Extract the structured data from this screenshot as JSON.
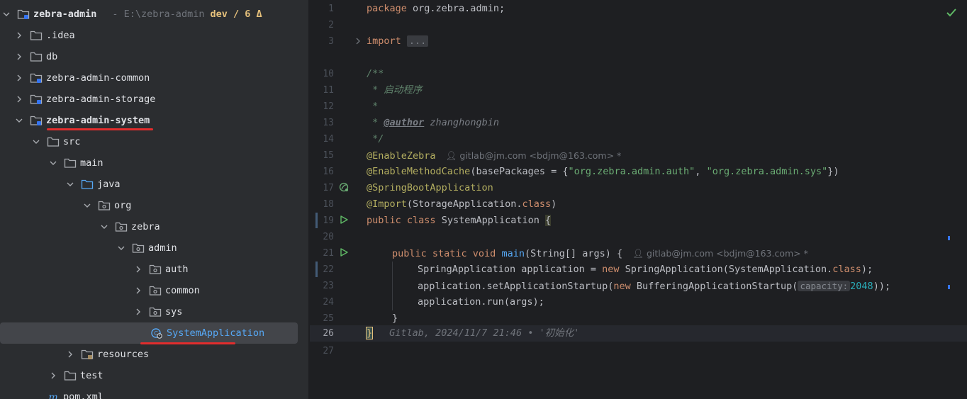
{
  "project_tree": {
    "root": {
      "name": "zebra-admin",
      "path": "- E:\\zebra-admin",
      "branch": "dev / 6 Δ"
    },
    "items": [
      {
        "label": ".idea"
      },
      {
        "label": "db"
      },
      {
        "label": "zebra-admin-common"
      },
      {
        "label": "zebra-admin-storage"
      },
      {
        "label": "zebra-admin-system"
      },
      {
        "label": "src"
      },
      {
        "label": "main"
      },
      {
        "label": "java"
      },
      {
        "label": "org"
      },
      {
        "label": "zebra"
      },
      {
        "label": "admin"
      },
      {
        "label": "auth"
      },
      {
        "label": "common"
      },
      {
        "label": "sys"
      },
      {
        "label": "SystemApplication"
      },
      {
        "label": "resources"
      },
      {
        "label": "test"
      },
      {
        "label": "pom.xml"
      }
    ]
  },
  "editor": {
    "line_numbers": [
      "1",
      "2",
      "3",
      "10",
      "11",
      "12",
      "13",
      "14",
      "15",
      "16",
      "17",
      "18",
      "19",
      "20",
      "21",
      "22",
      "23",
      "24",
      "25",
      "26",
      "27"
    ],
    "code": {
      "l1_kw": "package",
      "l1_rest": " org.zebra.admin;",
      "l3_kw": "import",
      "l3_fold": "...",
      "l10": "/**",
      "l11": " * 启动程序",
      "l12": " *",
      "l13_pre": " * ",
      "l13_tag": "@author",
      "l13_name": " zhanghongbin",
      "l14": " */",
      "l15_ann": "@EnableZebra",
      "l15_blame": "gitlab@jm.com <bdjm@163.com> *",
      "l16_ann": "@EnableMethodCache",
      "l16_a": "(basePackages = {",
      "l16_s1": "\"org.zebra.admin.auth\"",
      "l16_b": ", ",
      "l16_s2": "\"org.zebra.admin.sys\"",
      "l16_c": "})",
      "l17_ann": "@SpringBootApplication",
      "l18_ann": "@Import",
      "l18_a": "(StorageApplication.",
      "l18_kw": "class",
      "l18_b": ")",
      "l19_kw1": "public",
      "l19_kw2": "class",
      "l19_name": " SystemApplication ",
      "l19_brace": "{",
      "l21_kw": "public static void",
      "l21_fn": "main",
      "l21_rest": "(String[] args) {",
      "l21_blame": "gitlab@jm.com <bdjm@163.com> *",
      "l22_a": "SpringApplication application = ",
      "l22_kw": "new",
      "l22_b": " SpringApplication(SystemApplication.",
      "l22_kw2": "class",
      "l22_c": ");",
      "l23_a": "application.setApplicationStartup(",
      "l23_kw": "new",
      "l23_b": " BufferingApplicationStartup(",
      "l23_hint": "capacity:",
      "l23_num": "2048",
      "l23_c": "));",
      "l24": "application.run(args);",
      "l25": "}",
      "l26_brace": "}",
      "l26_blame": "Gitlab, 2024/11/7 21:46 • '初始化'"
    }
  }
}
